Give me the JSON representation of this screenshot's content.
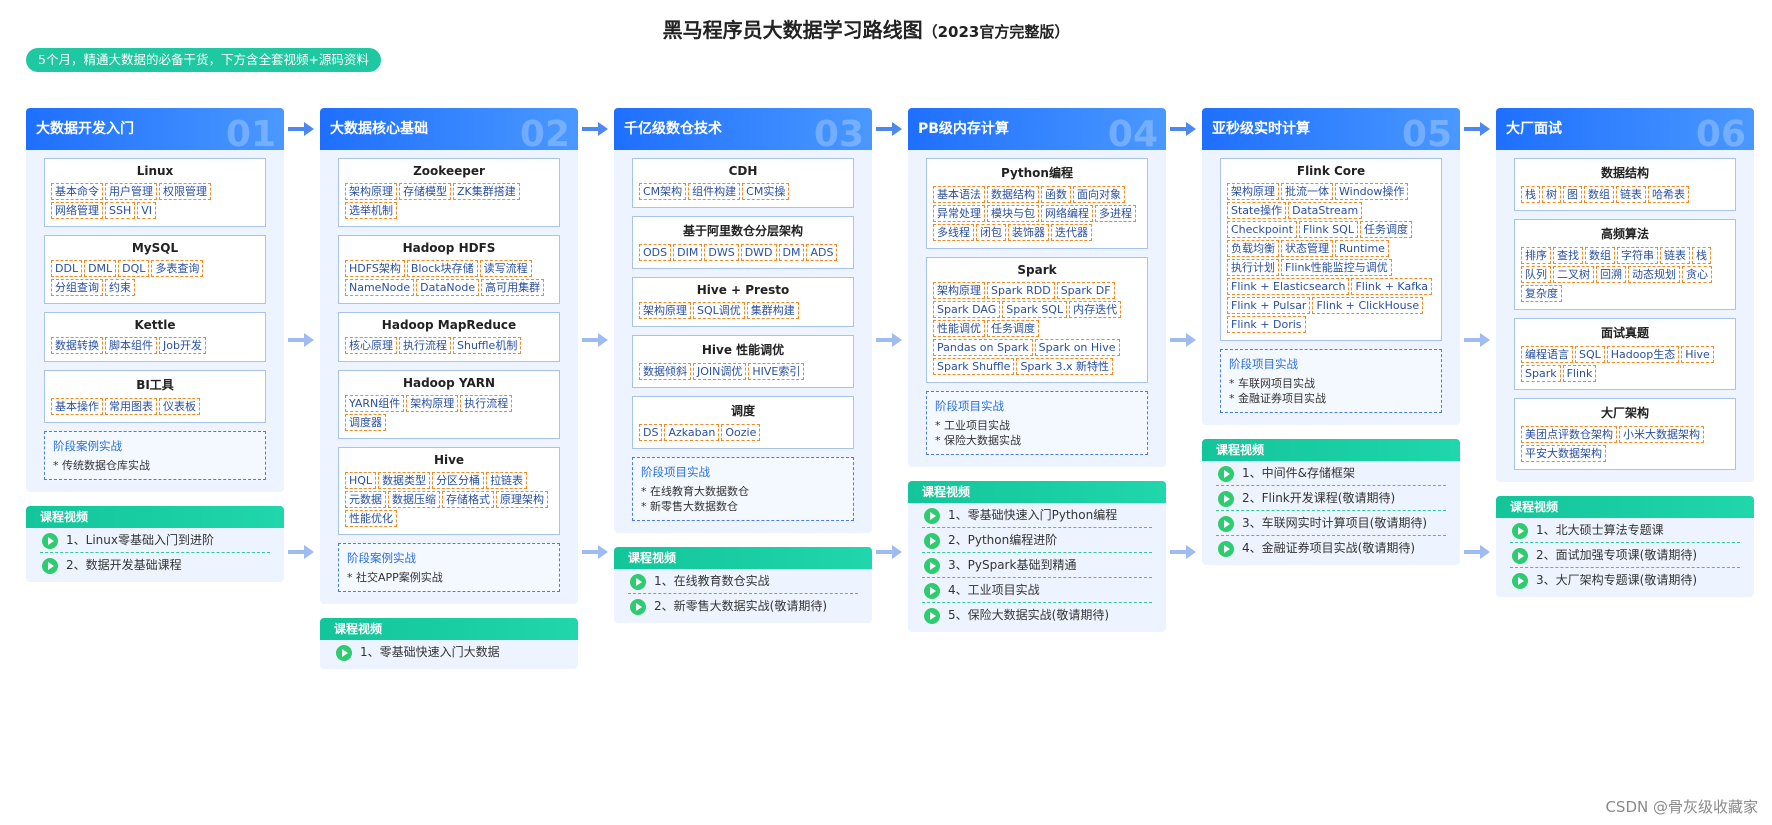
{
  "title": "黑马程序员大数据学习路线图",
  "subtitle": "（2023官方完整版）",
  "pill": "5个月，精通大数据的必备干货，下方含全套视频+源码资料",
  "video_label": "课程视频",
  "watermark": "CSDN @骨灰级收藏家",
  "columns": [
    {
      "title": "大数据开发入门",
      "num": "01",
      "boxes": [
        {
          "title": "Linux",
          "tags": [
            "基本命令",
            "用户管理",
            "权限管理",
            "网络管理",
            "SSH",
            "VI"
          ]
        },
        {
          "title": "MySQL",
          "tags": [
            "DDL",
            "DML",
            "DQL",
            "多表查询",
            "分组查询",
            "约束"
          ]
        },
        {
          "title": "Kettle",
          "tags": [
            "数据转换",
            "脚本组件",
            "Job开发"
          ]
        },
        {
          "title": "BI工具",
          "tags": [
            "基本操作",
            "常用图表",
            "仪表板"
          ]
        }
      ],
      "project": {
        "title": "阶段案例实战",
        "items": [
          "* 传统数据仓库实战"
        ]
      },
      "videos": [
        "1、Linux零基础入门到进阶",
        "2、数据开发基础课程"
      ]
    },
    {
      "title": "大数据核心基础",
      "num": "02",
      "boxes": [
        {
          "title": "Zookeeper",
          "tags": [
            "架构原理",
            "存储模型",
            "ZK集群搭建",
            "选举机制"
          ]
        },
        {
          "title": "Hadoop HDFS",
          "tags": [
            "HDFS架构",
            "Block块存储",
            "读写流程",
            "NameNode",
            "DataNode",
            "高可用集群"
          ]
        },
        {
          "title": "Hadoop MapReduce",
          "tags": [
            "核心原理",
            "执行流程",
            "Shuffle机制"
          ]
        },
        {
          "title": "Hadoop YARN",
          "tags": [
            "YARN组件",
            "架构原理",
            "执行流程",
            "调度器"
          ]
        },
        {
          "title": "Hive",
          "tags": [
            "HQL",
            "数据类型",
            "分区分桶",
            "拉链表",
            "元数据",
            "数据压缩",
            "存储格式",
            "原理架构",
            "性能优化"
          ]
        }
      ],
      "project": {
        "title": "阶段案例实战",
        "items": [
          "* 社交APP案例实战"
        ]
      },
      "videos": [
        "1、零基础快速入门大数据"
      ]
    },
    {
      "title": "千亿级数仓技术",
      "num": "03",
      "boxes": [
        {
          "title": "CDH",
          "tags": [
            "CM架构",
            "组件构建",
            "CM实操"
          ]
        },
        {
          "title": "基于阿里数仓分层架构",
          "tags": [
            "ODS",
            "DIM",
            "DWS",
            "DWD",
            "DM",
            "ADS"
          ]
        },
        {
          "title": "Hive + Presto",
          "tags": [
            "架构原理",
            "SQL调优",
            "集群构建"
          ]
        },
        {
          "title": "Hive 性能调优",
          "tags": [
            "数据倾斜",
            "JOIN调优",
            "HIVE索引"
          ]
        },
        {
          "title": "调度",
          "tags": [
            "DS",
            "Azkaban",
            "Oozie"
          ]
        }
      ],
      "project": {
        "title": "阶段项目实战",
        "items": [
          "* 在线教育大数据数仓",
          "* 新零售大数据数仓"
        ]
      },
      "videos": [
        "1、在线教育数仓实战",
        "2、新零售大数据实战(敬请期待)"
      ]
    },
    {
      "title": "PB级内存计算",
      "num": "04",
      "boxes": [
        {
          "title": "Python编程",
          "tags": [
            "基本语法",
            "数据结构",
            "函数",
            "面向对象",
            "异常处理",
            "模块与包",
            "网络编程",
            "多进程",
            "多线程",
            "闭包",
            "装饰器",
            "迭代器"
          ]
        },
        {
          "title": "Spark",
          "tags": [
            "架构原理",
            "Spark RDD",
            "Spark DF",
            "Spark DAG",
            "Spark SQL",
            "内存迭代",
            "性能调优",
            "任务调度",
            "Pandas on Spark",
            "Spark on Hive",
            "Spark Shuffle",
            "Spark 3.x 新特性"
          ]
        }
      ],
      "project": {
        "title": "阶段项目实战",
        "items": [
          "* 工业项目实战",
          "* 保险大数据实战"
        ]
      },
      "videos": [
        "1、零基础快速入门Python编程",
        "2、Python编程进阶",
        "3、PySpark基础到精通",
        "4、工业项目实战",
        "5、保险大数据实战(敬请期待)"
      ]
    },
    {
      "title": "亚秒级实时计算",
      "num": "05",
      "boxes": [
        {
          "title": "Flink Core",
          "tags": [
            "架构原理",
            "批流一体",
            "Window操作",
            "State操作",
            "DataStream",
            "Checkpoint",
            "Flink SQL",
            "任务调度",
            "负载均衡",
            "状态管理",
            "Runtime",
            "执行计划",
            "Flink性能监控与调优",
            "Flink + Elasticsearch",
            "Flink + Kafka",
            "Flink + Pulsar",
            "Flink + ClickHouse",
            "Flink + Doris"
          ]
        }
      ],
      "project": {
        "title": "阶段项目实战",
        "items": [
          "* 车联网项目实战",
          "* 金融证券项目实战"
        ]
      },
      "videos": [
        "1、中间件&存储框架",
        "2、Flink开发课程(敬请期待)",
        "3、车联网实时计算项目(敬请期待)",
        "4、金融证券项目实战(敬请期待)"
      ]
    },
    {
      "title": "大厂面试",
      "num": "06",
      "boxes": [
        {
          "title": "数据结构",
          "tags": [
            "栈",
            "树",
            "图",
            "数组",
            "链表",
            "哈希表"
          ]
        },
        {
          "title": "高频算法",
          "tags": [
            "排序",
            "查找",
            "数组",
            "字符串",
            "链表",
            "栈",
            "队列",
            "二叉树",
            "回溯",
            "动态规划",
            "贪心",
            "复杂度"
          ]
        },
        {
          "title": "面试真题",
          "tags": [
            "编程语言",
            "SQL",
            "Hadoop生态",
            "Hive",
            "Spark",
            "Flink"
          ]
        },
        {
          "title": "大厂架构",
          "tags": [
            "美团点评数仓架构",
            "小米大数据架构",
            "平安大数据架构"
          ]
        }
      ],
      "project": null,
      "videos": [
        "1、北大硕士算法专题课",
        "2、面试加强专项课(敬请期待)",
        "3、大厂架构专题课(敬请期待)"
      ]
    }
  ]
}
